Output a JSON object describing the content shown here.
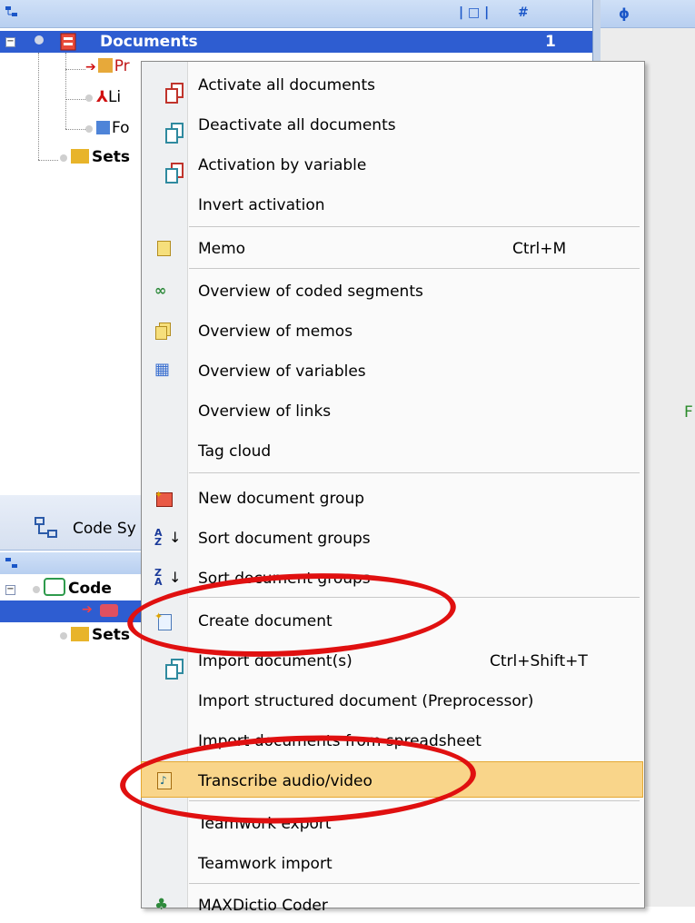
{
  "top_tree": {
    "root_label": "Documents",
    "root_count": "1",
    "child_1": "Pr",
    "child_2": "Li",
    "child_3": "Fo",
    "sets_label": "Sets"
  },
  "code_window": {
    "title": "Code Sy",
    "root_label": "Code",
    "sets_label": "Sets"
  },
  "right_pane": {
    "fragment": "F"
  },
  "menu": {
    "items": [
      {
        "label": "Activate all documents",
        "shortcut": "",
        "icon": "activate-docs-icon"
      },
      {
        "label": "Deactivate all documents",
        "shortcut": "",
        "icon": "deactivate-docs-icon"
      },
      {
        "label": "Activation by variable",
        "shortcut": "",
        "icon": "activation-variable-icon"
      },
      {
        "label": "Invert activation",
        "shortcut": "",
        "icon": ""
      },
      {
        "label": "Memo",
        "shortcut": "Ctrl+M",
        "icon": "memo-icon"
      },
      {
        "label": "Overview of coded segments",
        "shortcut": "",
        "icon": "coded-segments-icon"
      },
      {
        "label": "Overview of memos",
        "shortcut": "",
        "icon": "memos-overview-icon"
      },
      {
        "label": "Overview of variables",
        "shortcut": "",
        "icon": "variables-grid-icon"
      },
      {
        "label": "Overview of links",
        "shortcut": "",
        "icon": ""
      },
      {
        "label": "Tag cloud",
        "shortcut": "",
        "icon": ""
      },
      {
        "label": "New document group",
        "shortcut": "",
        "icon": "new-group-icon"
      },
      {
        "label": "Sort document groups",
        "shortcut": "",
        "icon": "sort-az-icon"
      },
      {
        "label": "Sort document groups",
        "shortcut": "",
        "icon": "sort-za-icon"
      },
      {
        "label": "Create document",
        "shortcut": "",
        "icon": "create-document-icon"
      },
      {
        "label": "Import document(s)",
        "shortcut": "Ctrl+Shift+T",
        "icon": "import-docs-icon"
      },
      {
        "label": "Import structured document (Preprocessor)",
        "shortcut": "",
        "icon": ""
      },
      {
        "label": "Import documents from spreadsheet",
        "shortcut": "",
        "icon": ""
      },
      {
        "label": "Transcribe audio/video",
        "shortcut": "",
        "icon": "transcribe-icon"
      },
      {
        "label": "Teamwork export",
        "shortcut": "",
        "icon": ""
      },
      {
        "label": "Teamwork import",
        "shortcut": "",
        "icon": ""
      },
      {
        "label": "MAXDictio Coder",
        "shortcut": "",
        "icon": "maxdictio-icon"
      }
    ]
  },
  "colors": {
    "selection": "#2e5dd1",
    "highlight": "#f9d58a",
    "annotation": "#e01010"
  }
}
